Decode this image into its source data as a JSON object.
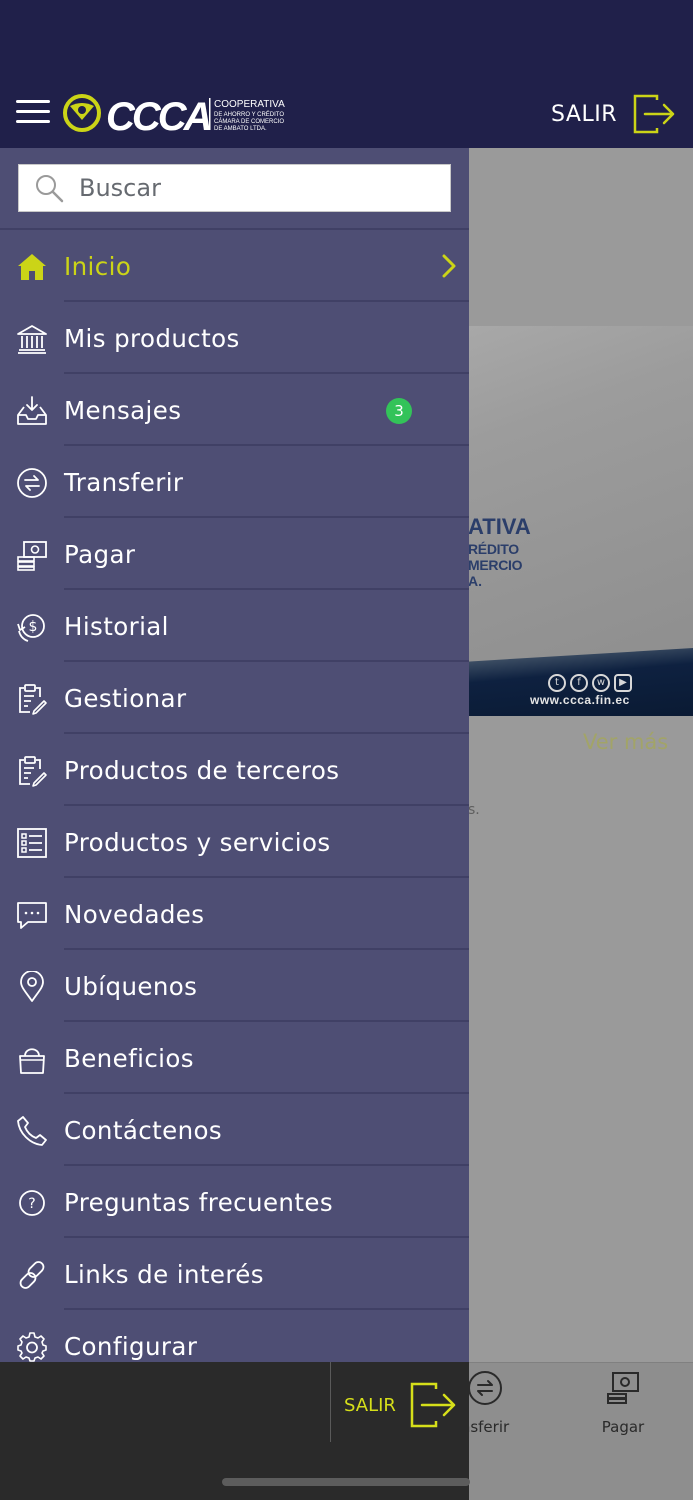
{
  "header": {
    "logo_text": "CCCA",
    "logo_subtitle_lines": [
      "COOPERATIVA",
      "DE AHORRO Y CRÉDITO",
      "CÁMARA DE COMERCIO",
      "DE AMBATO LTDA."
    ],
    "salir_label": "SALIR"
  },
  "search": {
    "placeholder": "Buscar",
    "value": ""
  },
  "menu": {
    "items": [
      {
        "label": "Inicio",
        "icon": "home-icon",
        "active": true
      },
      {
        "label": "Mis productos",
        "icon": "bank-icon"
      },
      {
        "label": "Mensajes",
        "icon": "inbox-icon",
        "badge": "3"
      },
      {
        "label": "Transferir",
        "icon": "transfer-icon"
      },
      {
        "label": "Pagar",
        "icon": "payment-icon"
      },
      {
        "label": "Historial",
        "icon": "history-icon"
      },
      {
        "label": "Gestionar",
        "icon": "clipboard-edit-icon"
      },
      {
        "label": "Productos de terceros",
        "icon": "clipboard-edit-icon"
      },
      {
        "label": "Productos y servicios",
        "icon": "list-document-icon"
      },
      {
        "label": "Novedades",
        "icon": "chat-bubble-icon"
      },
      {
        "label": "Ubíquenos",
        "icon": "location-pin-icon"
      },
      {
        "label": "Beneficios",
        "icon": "bag-icon"
      },
      {
        "label": "Contáctenos",
        "icon": "phone-icon"
      },
      {
        "label": "Preguntas frecuentes",
        "icon": "question-icon"
      },
      {
        "label": "Links de interés",
        "icon": "link-icon"
      },
      {
        "label": "Configurar",
        "icon": "gear-icon"
      }
    ]
  },
  "footer": {
    "salir_label": "SALIR"
  },
  "background": {
    "banner_lines": [
      "ATIVA",
      "RÉDITO",
      "MERCIO",
      "A."
    ],
    "banner_url": "www.ccca.fin.ec",
    "ver_mas": "Ver más",
    "partial_text": "s.",
    "tabs": [
      {
        "label": "nsferir",
        "icon": "transfer-icon"
      },
      {
        "label": "Pagar",
        "icon": "payment-icon"
      }
    ]
  },
  "colors": {
    "header_bg": "#20204a",
    "drawer_bg": "#4e4e74",
    "accent": "#cbd417",
    "badge": "#33c359",
    "footer_bg": "#2a2a2a"
  }
}
